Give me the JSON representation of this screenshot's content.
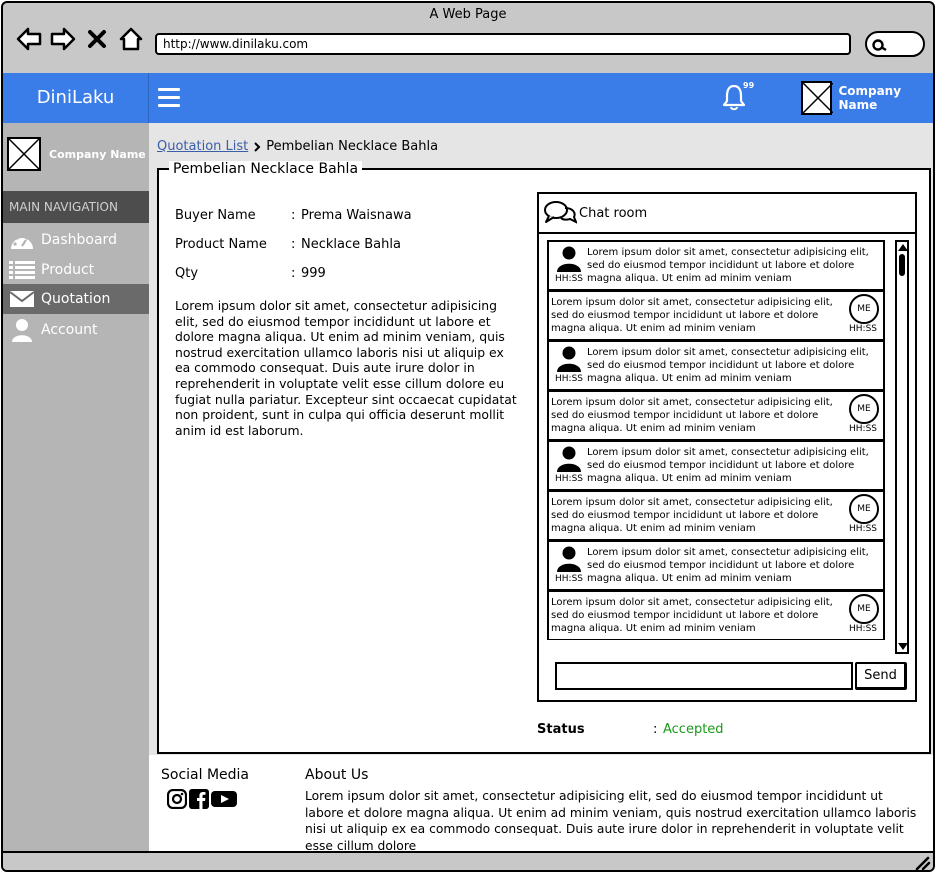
{
  "browser": {
    "title": "A Web Page",
    "url": "http://www.dinilaku.com"
  },
  "header": {
    "brand": "DiniLaku",
    "notification_count": "99",
    "company_name": "Company Name"
  },
  "sidebar": {
    "company_name": "Company Name",
    "section_title": "MAIN NAVIGATION",
    "items": [
      {
        "label": "Dashboard",
        "icon": "dashboard-icon"
      },
      {
        "label": "Product",
        "icon": "list-icon"
      },
      {
        "label": "Quotation",
        "icon": "envelope-icon",
        "active": true
      },
      {
        "label": "Account",
        "icon": "user-icon"
      }
    ]
  },
  "breadcrumb": {
    "parent": "Quotation List",
    "current": "Pembelian Necklace Bahla"
  },
  "detail": {
    "title": "Pembelian Necklace Bahla",
    "fields": [
      {
        "label": "Buyer Name",
        "sep": ":",
        "value": "Prema Waisnawa"
      },
      {
        "label": "Product Name",
        "sep": ":",
        "value": "Necklace Bahla"
      },
      {
        "label": "Qty",
        "sep": ":",
        "value": "999"
      }
    ],
    "description": "Lorem ipsum dolor sit amet, consectetur adipisicing elit, sed do eiusmod tempor incididunt ut labore et dolore magna aliqua. Ut enim ad minim veniam, quis nostrud exercitation ullamco laboris nisi ut aliquip ex ea commodo consequat. Duis aute irure dolor in reprehenderit in voluptate velit esse cillum dolore eu fugiat nulla pariatur. Excepteur sint occaecat cupidatat non proident, sunt in culpa qui officia deserunt mollit anim id est laborum."
  },
  "chat": {
    "title": "Chat room",
    "send_label": "Send",
    "me_label": "ME",
    "messages": [
      {
        "from": "them",
        "text": "Lorem ipsum dolor sit amet, consectetur adipisicing elit, sed do eiusmod tempor incididunt ut labore et dolore magna aliqua. Ut enim ad minim veniam",
        "time": "HH:SS"
      },
      {
        "from": "me",
        "text": "Lorem ipsum dolor sit amet, consectetur adipisicing elit, sed do eiusmod tempor incididunt ut labore et dolore magna aliqua. Ut enim ad minim veniam",
        "time": "HH:SS"
      },
      {
        "from": "them",
        "text": "Lorem ipsum dolor sit amet, consectetur adipisicing elit, sed do eiusmod tempor incididunt ut labore et dolore magna aliqua. Ut enim ad minim veniam",
        "time": "HH:SS"
      },
      {
        "from": "me",
        "text": "Lorem ipsum dolor sit amet, consectetur adipisicing elit, sed do eiusmod tempor incididunt ut labore et dolore magna aliqua. Ut enim ad minim veniam",
        "time": "HH:SS"
      },
      {
        "from": "them",
        "text": "Lorem ipsum dolor sit amet, consectetur adipisicing elit, sed do eiusmod tempor incididunt ut labore et dolore magna aliqua. Ut enim ad minim veniam",
        "time": "HH:SS"
      },
      {
        "from": "me",
        "text": "Lorem ipsum dolor sit amet, consectetur adipisicing elit, sed do eiusmod tempor incididunt ut labore et dolore magna aliqua. Ut enim ad minim veniam",
        "time": "HH:SS"
      },
      {
        "from": "them",
        "text": "Lorem ipsum dolor sit amet, consectetur adipisicing elit, sed do eiusmod tempor incididunt ut labore et dolore magna aliqua. Ut enim ad minim veniam",
        "time": "HH:SS"
      },
      {
        "from": "me",
        "text": "Lorem ipsum dolor sit amet, consectetur adipisicing elit, sed do eiusmod tempor incididunt ut labore et dolore magna aliqua. Ut enim ad minim veniam",
        "time": "HH:SS"
      }
    ]
  },
  "status": {
    "label": "Status",
    "sep": ":",
    "value": "Accepted",
    "color": "#1a9a1a"
  },
  "footer": {
    "social_title": "Social Media",
    "social_icons": [
      "instagram-icon",
      "facebook-icon",
      "youtube-icon"
    ],
    "about_title": "About Us",
    "about_text": "Lorem ipsum dolor sit amet, consectetur adipisicing elit, sed do eiusmod tempor incididunt ut labore et dolore magna aliqua. Ut enim ad minim veniam, quis nostrud exercitation ullamco laboris nisi ut aliquip ex ea commodo consequat. Duis aute irure dolor in reprehenderit in voluptate velit esse cillum dolore"
  },
  "colors": {
    "header_blue": "#3b7de8",
    "sidebar_gray": "#b5b5b5",
    "nav_section_dark": "#4d4d4d",
    "active_item": "#6a6a6a"
  }
}
